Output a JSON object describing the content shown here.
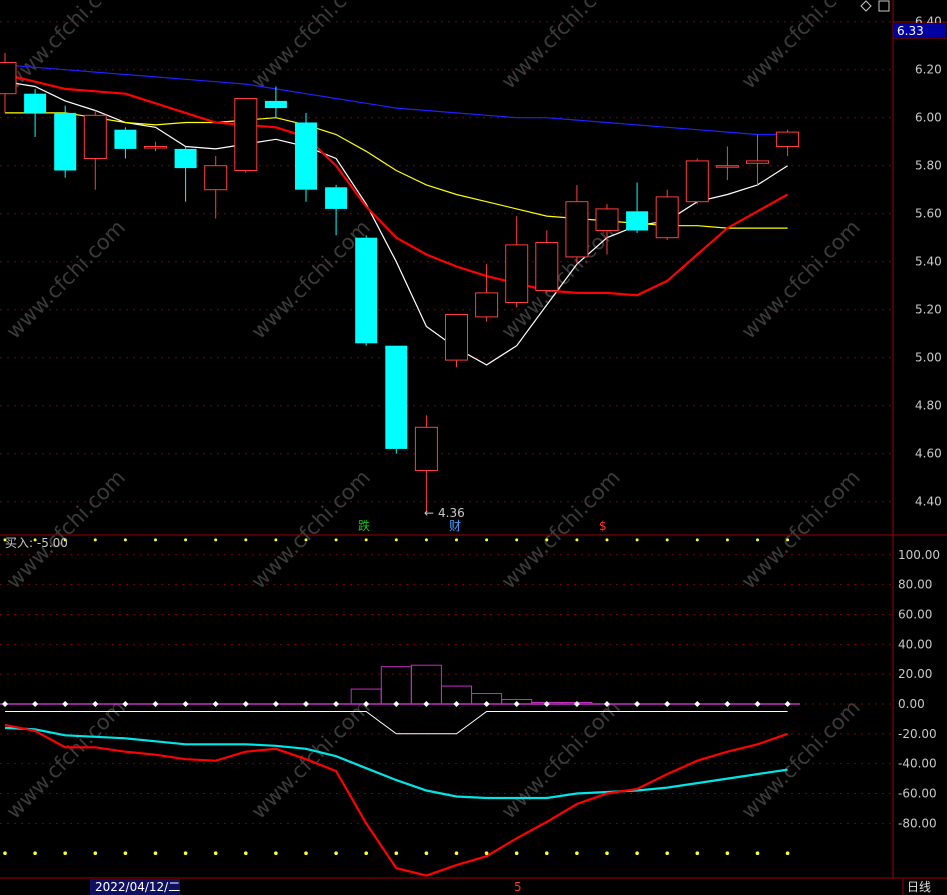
{
  "header": {
    "diamond_icon": "diamond-icon",
    "window_icon": "window-icon",
    "price_tag": "6.33"
  },
  "watermark": "www.cfchi.com",
  "main": {
    "min_label": "4.36",
    "event_marks": [
      "跌",
      "财",
      "$"
    ]
  },
  "indicator": {
    "title": "买入: -5.00"
  },
  "footer": {
    "date": "2022/04/12/二",
    "marker": "5",
    "period_button": "日线"
  },
  "colors": {
    "bg": "#000000",
    "frame": "#a00000",
    "grid": "#7a0000",
    "up": "#ff3c3c",
    "down": "#00ffff",
    "ma5": "#ffffff",
    "ma10": "#ffff00",
    "ma20": "#ff0000",
    "ma60": "#2020ff",
    "hist": "#c030c0",
    "dots": "#ffff30"
  },
  "chart_data": [
    {
      "type": "candlestick",
      "ylim": [
        4.3,
        6.4
      ],
      "y_ticks": [
        "6.40",
        "6.20",
        "6.00",
        "5.80",
        "5.60",
        "5.40",
        "5.20",
        "5.00",
        "4.80",
        "4.60",
        "4.40"
      ],
      "candles": [
        {
          "o": 6.1,
          "h": 6.27,
          "l": 6.02,
          "c": 6.23
        },
        {
          "o": 6.1,
          "h": 6.12,
          "l": 5.92,
          "c": 6.02
        },
        {
          "o": 6.02,
          "h": 6.05,
          "l": 5.75,
          "c": 5.78
        },
        {
          "o": 5.83,
          "h": 6.03,
          "l": 5.7,
          "c": 6.01
        },
        {
          "o": 5.95,
          "h": 5.96,
          "l": 5.83,
          "c": 5.87
        },
        {
          "o": 5.88,
          "h": 5.9,
          "l": 5.86,
          "c": 5.88
        },
        {
          "o": 5.87,
          "h": 5.88,
          "l": 5.65,
          "c": 5.79
        },
        {
          "o": 5.7,
          "h": 5.84,
          "l": 5.58,
          "c": 5.8
        },
        {
          "o": 5.78,
          "h": 6.08,
          "l": 5.77,
          "c": 6.08
        },
        {
          "o": 6.07,
          "h": 6.13,
          "l": 6.0,
          "c": 6.04
        },
        {
          "o": 5.98,
          "h": 6.02,
          "l": 5.65,
          "c": 5.7
        },
        {
          "o": 5.71,
          "h": 5.72,
          "l": 5.51,
          "c": 5.62
        },
        {
          "o": 5.5,
          "h": 5.51,
          "l": 5.05,
          "c": 5.06
        },
        {
          "o": 5.05,
          "h": 5.05,
          "l": 4.6,
          "c": 4.62
        },
        {
          "o": 4.53,
          "h": 4.76,
          "l": 4.36,
          "c": 4.71
        },
        {
          "o": 4.99,
          "h": 5.17,
          "l": 4.96,
          "c": 5.18
        },
        {
          "o": 5.17,
          "h": 5.39,
          "l": 5.15,
          "c": 5.27
        },
        {
          "o": 5.23,
          "h": 5.59,
          "l": 5.21,
          "c": 5.47
        },
        {
          "o": 5.28,
          "h": 5.53,
          "l": 5.27,
          "c": 5.48
        },
        {
          "o": 5.42,
          "h": 5.72,
          "l": 5.39,
          "c": 5.65
        },
        {
          "o": 5.53,
          "h": 5.64,
          "l": 5.43,
          "c": 5.62
        },
        {
          "o": 5.61,
          "h": 5.73,
          "l": 5.52,
          "c": 5.53
        },
        {
          "o": 5.5,
          "h": 5.7,
          "l": 5.49,
          "c": 5.67
        },
        {
          "o": 5.65,
          "h": 5.83,
          "l": 5.64,
          "c": 5.82
        },
        {
          "o": 5.8,
          "h": 5.88,
          "l": 5.74,
          "c": 5.8
        },
        {
          "o": 5.81,
          "h": 5.93,
          "l": 5.72,
          "c": 5.82
        },
        {
          "o": 5.88,
          "h": 5.95,
          "l": 5.84,
          "c": 5.94
        }
      ],
      "ma": [
        {
          "name": "MA5",
          "color": "#ffffff",
          "values": [
            6.15,
            6.13,
            6.07,
            6.03,
            5.98,
            5.96,
            5.88,
            5.87,
            5.89,
            5.91,
            5.88,
            5.83,
            5.64,
            5.4,
            5.13,
            5.04,
            4.97,
            5.05,
            5.22,
            5.39,
            5.5,
            5.55,
            5.57,
            5.65,
            5.68,
            5.72,
            5.8
          ]
        },
        {
          "name": "MA10",
          "color": "#ffff00",
          "values": [
            6.02,
            6.02,
            6.02,
            6.0,
            5.98,
            5.97,
            5.98,
            5.98,
            5.99,
            6.0,
            5.97,
            5.93,
            5.86,
            5.78,
            5.72,
            5.68,
            5.65,
            5.62,
            5.59,
            5.58,
            5.57,
            5.56,
            5.55,
            5.55,
            5.54,
            5.54,
            5.54
          ]
        },
        {
          "name": "MA20",
          "color": "#ff0000",
          "values": [
            6.18,
            6.15,
            6.12,
            6.11,
            6.1,
            6.06,
            6.02,
            5.98,
            5.97,
            5.96,
            5.92,
            5.8,
            5.63,
            5.5,
            5.43,
            5.38,
            5.34,
            5.31,
            5.28,
            5.27,
            5.27,
            5.26,
            5.32,
            5.43,
            5.54,
            5.61,
            5.68
          ]
        },
        {
          "name": "MA60",
          "color": "#2020ff",
          "values": [
            6.22,
            6.21,
            6.2,
            6.19,
            6.18,
            6.17,
            6.16,
            6.15,
            6.14,
            6.12,
            6.1,
            6.08,
            6.06,
            6.04,
            6.03,
            6.02,
            6.01,
            6.0,
            6.0,
            5.99,
            5.98,
            5.97,
            5.96,
            5.95,
            5.94,
            5.93,
            5.93
          ]
        }
      ]
    },
    {
      "type": "line",
      "ylim": [
        -100,
        110
      ],
      "y_ticks": [
        "100.00",
        "80.00",
        "60.00",
        "40.00",
        "20.00",
        "0.00",
        "-20.00",
        "-40.00",
        "-60.00",
        "-80.00"
      ],
      "histogram": [
        0,
        0,
        0,
        0,
        0,
        0,
        0,
        0,
        0,
        0,
        0,
        0,
        10,
        25,
        26,
        12,
        7,
        3,
        1,
        1,
        0,
        0,
        0,
        0,
        0,
        0,
        0
      ],
      "lines": [
        {
          "color": "#00e5e5",
          "values": [
            -16,
            -17,
            -21,
            -22,
            -23,
            -25,
            -27,
            -27,
            -27,
            -28,
            -30,
            -35,
            -43,
            -51,
            -58,
            -62,
            -63,
            -63,
            -63,
            -60,
            -59,
            -58,
            -56,
            -53,
            -50,
            -47,
            -44
          ]
        },
        {
          "color": "#ff0000",
          "values": [
            -14,
            -18,
            -29,
            -29,
            -32,
            -34,
            -37,
            -38,
            -32,
            -30,
            -37,
            -45,
            -80,
            -110,
            -115,
            -108,
            -102,
            -90,
            -79,
            -67,
            -60,
            -57,
            -47,
            -38,
            -32,
            -27,
            -20
          ]
        },
        {
          "color": "#ffffff",
          "values": [
            -5,
            -5,
            -5,
            -5,
            -5,
            -5,
            -5,
            -5,
            -5,
            -5,
            -5,
            -5,
            -5,
            -20,
            -20,
            -20,
            -5,
            -5,
            -5,
            -5,
            -5,
            -5,
            -5,
            -5,
            -5,
            -5,
            -5
          ]
        }
      ],
      "upper_dots": 110,
      "lower_dots": -100
    }
  ]
}
